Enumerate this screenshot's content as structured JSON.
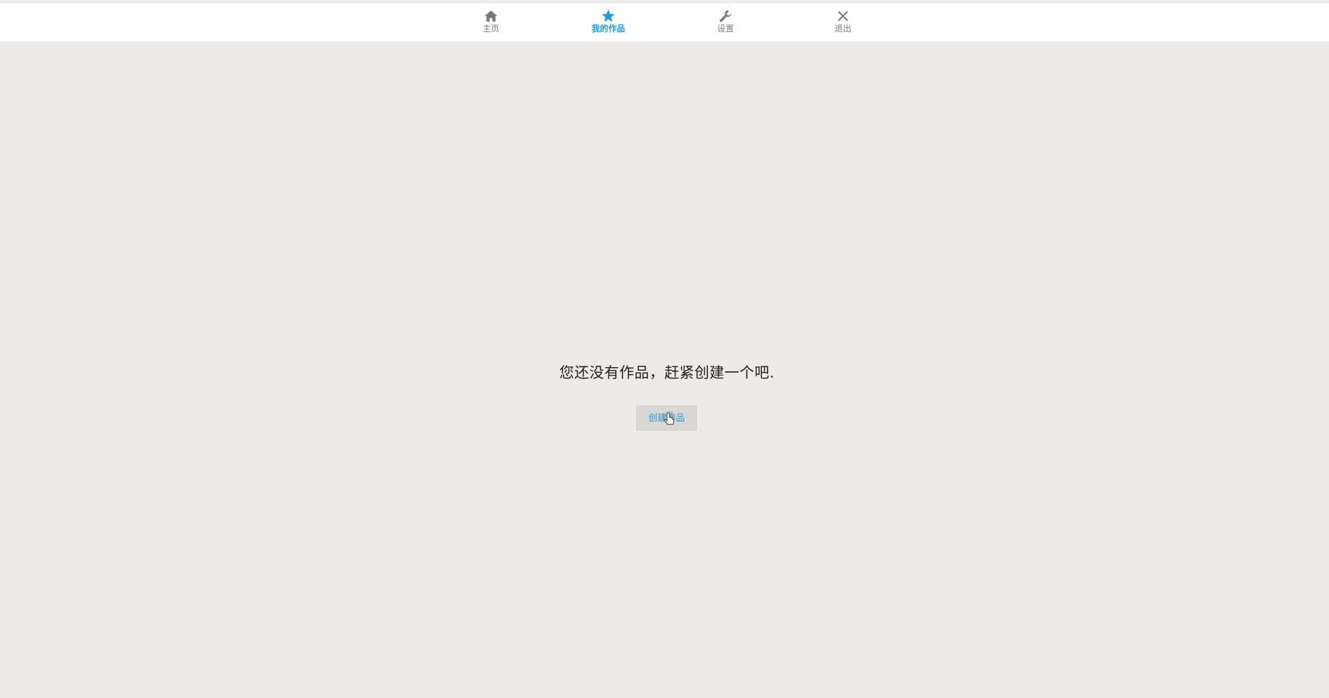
{
  "nav": {
    "items": [
      {
        "label": "主页",
        "icon": "home-icon"
      },
      {
        "label": "我的作品",
        "icon": "star-icon",
        "active": true
      },
      {
        "label": "设置",
        "icon": "wrench-icon"
      },
      {
        "label": "退出",
        "icon": "close-icon"
      }
    ]
  },
  "main": {
    "empty_message": "您还没有作品，赶紧创建一个吧.",
    "create_button_label": "创建作品"
  },
  "colors": {
    "accent": "#1a9de0",
    "background": "#eeeae7",
    "nav_inactive": "#7a7a7a"
  }
}
